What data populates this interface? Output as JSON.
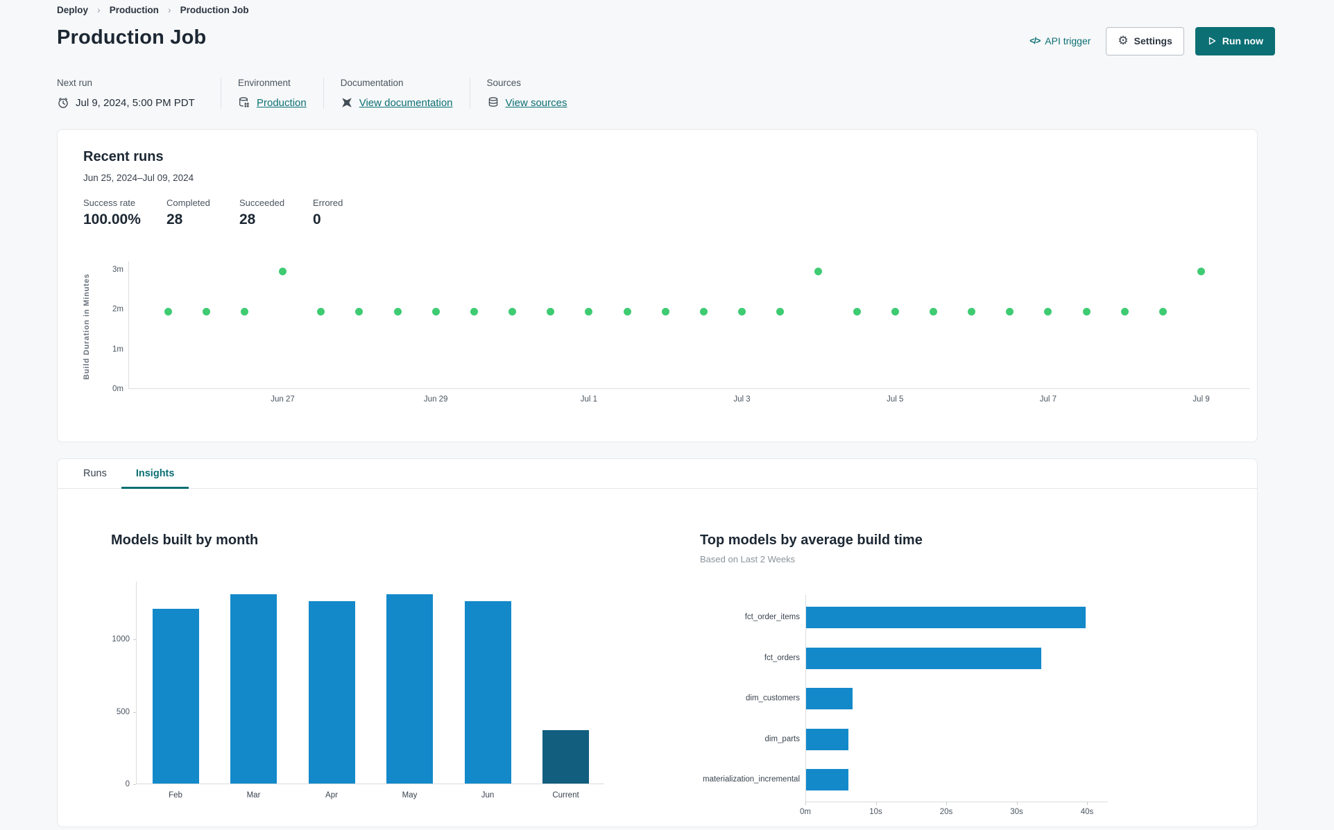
{
  "breadcrumb": {
    "items": [
      "Deploy",
      "Production",
      "Production Job"
    ]
  },
  "header": {
    "title": "Production Job",
    "api_trigger_label": "API trigger",
    "settings_label": "Settings",
    "run_now_label": "Run now"
  },
  "meta": {
    "next_run": {
      "label": "Next run",
      "value": "Jul 9, 2024, 5:00 PM PDT"
    },
    "environment": {
      "label": "Environment",
      "value": "Production"
    },
    "documentation": {
      "label": "Documentation",
      "value": "View documentation"
    },
    "sources": {
      "label": "Sources",
      "value": "View sources"
    }
  },
  "recent_runs": {
    "title": "Recent runs",
    "date_range": "Jun 25, 2024–Jul 09, 2024",
    "stats": [
      {
        "label": "Success rate",
        "value": "100.00%"
      },
      {
        "label": "Completed",
        "value": "28"
      },
      {
        "label": "Succeeded",
        "value": "28"
      },
      {
        "label": "Errored",
        "value": "0"
      }
    ]
  },
  "tabs": [
    {
      "label": "Runs",
      "active": false
    },
    {
      "label": "Insights",
      "active": true
    }
  ],
  "colors": {
    "accent_teal": "#0b6f74",
    "dot_green": "#3ecb72",
    "bar_blue": "#1389ca",
    "bar_dark": "#115e7e"
  },
  "chart_data": [
    {
      "type": "scatter",
      "ylabel": "Build Duration in Minutes",
      "y_ticks": [
        "0m",
        "1m",
        "2m",
        "3m"
      ],
      "y_tick_values": [
        0,
        1,
        2,
        3
      ],
      "ylim": [
        0,
        3.2
      ],
      "x_tick_labels": [
        "Jun 27",
        "Jun 29",
        "Jul 1",
        "Jul 3",
        "Jul 5",
        "Jul 7",
        "Jul 9"
      ],
      "x_tick_point_indices": [
        3,
        7,
        11,
        15,
        19,
        23,
        27
      ],
      "point_color": "#3ecb72",
      "durations_minutes": [
        1.95,
        1.95,
        1.95,
        2.95,
        1.95,
        1.95,
        1.95,
        1.95,
        1.95,
        1.95,
        1.95,
        1.95,
        1.95,
        1.95,
        1.95,
        1.95,
        1.95,
        2.95,
        1.95,
        1.95,
        1.95,
        1.95,
        1.95,
        1.95,
        1.95,
        1.95,
        1.95,
        2.95
      ]
    },
    {
      "type": "bar",
      "title": "Models built by month",
      "categories": [
        "Feb",
        "Mar",
        "Apr",
        "May",
        "Jun",
        "Current"
      ],
      "values": [
        1210,
        1310,
        1260,
        1310,
        1260,
        370
      ],
      "bar_colors": [
        "#1389ca",
        "#1389ca",
        "#1389ca",
        "#1389ca",
        "#1389ca",
        "#115e7e"
      ],
      "y_ticks": [
        0,
        500,
        1000
      ],
      "ylim": [
        0,
        1400
      ],
      "xlabel": "",
      "ylabel": ""
    },
    {
      "type": "bar-horizontal",
      "title": "Top models by average build time",
      "subtitle": "Based on Last 2 Weeks",
      "categories": [
        "fct_order_items",
        "fct_orders",
        "dim_customers",
        "dim_parts",
        "materialization_incremental"
      ],
      "values_seconds": [
        39.7,
        33.4,
        6.6,
        6.0,
        6.0
      ],
      "x_ticks": [
        "0m",
        "10s",
        "20s",
        "30s",
        "40s"
      ],
      "x_tick_values": [
        0,
        10,
        20,
        30,
        40
      ],
      "xlim": [
        0,
        43
      ],
      "bar_color": "#1389ca"
    }
  ]
}
